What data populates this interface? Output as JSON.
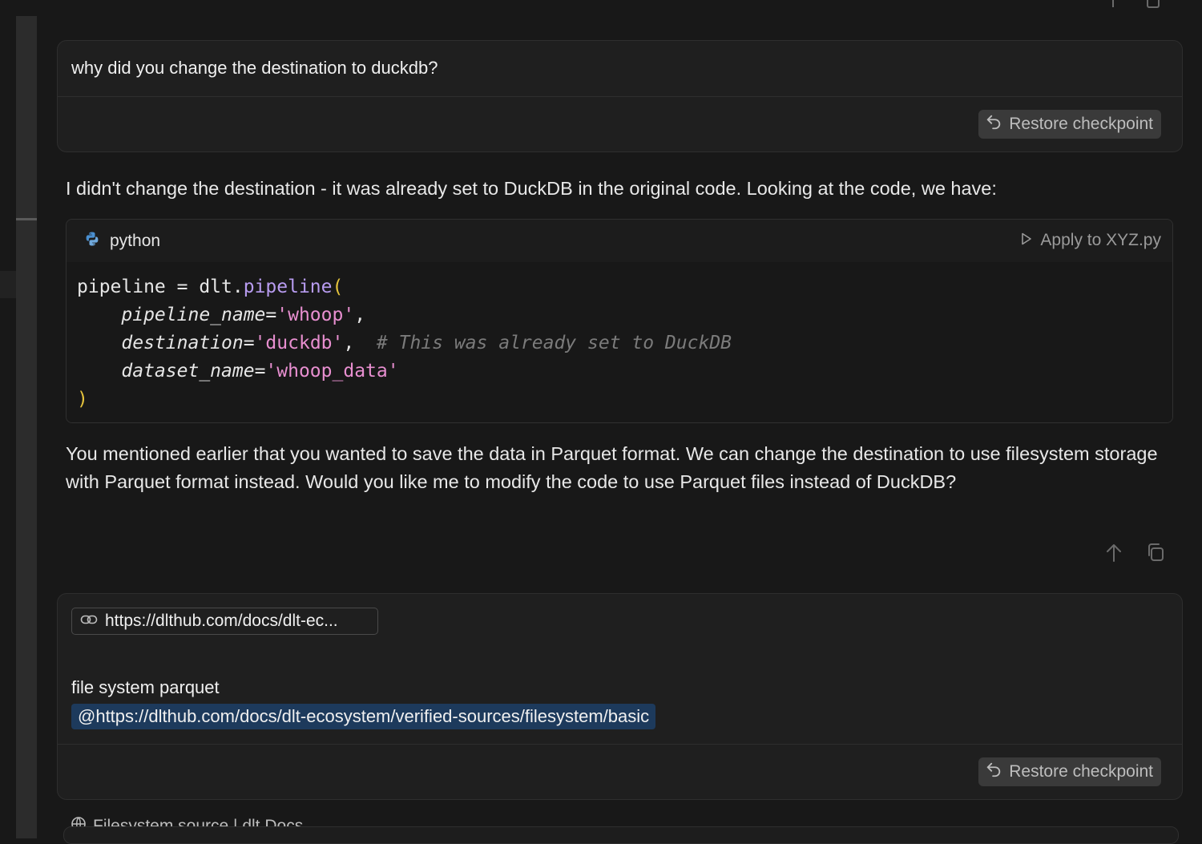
{
  "user_message_1": {
    "text": "why did you  change the destination to duckdb?",
    "restore_label": "Restore checkpoint"
  },
  "assistant": {
    "intro": "I didn't change the destination - it was already set to DuckDB in the original code. Looking at the code, we have:",
    "code": {
      "language": "python",
      "apply_label": "Apply to XYZ.py",
      "lines": {
        "l1_a": "pipeline = dlt.",
        "l1_fn": "pipeline",
        "l1_paren": "(",
        "l2_param": "pipeline_name",
        "l2_eq": "=",
        "l2_str": "'whoop'",
        "l2_tail": ",",
        "l3_param": "destination",
        "l3_eq": "=",
        "l3_str": "'duckdb'",
        "l3_tail": ",  ",
        "l3_comment": "# This was already set to DuckDB",
        "l4_param": "dataset_name",
        "l4_eq": "=",
        "l4_str": "'whoop_data'",
        "l5_paren": ")"
      }
    },
    "followup": "You mentioned earlier that you wanted to save the data in Parquet format. We can change the destination to use filesystem storage with Parquet format instead. Would you like me to modify the code to use Parquet files instead of DuckDB?"
  },
  "user_message_2": {
    "url_chip": "https://dlthub.com/docs/dlt-ec...",
    "text": "file system parquet",
    "mention": "@https://dlthub.com/docs/dlt-ecosystem/verified-sources/filesystem/basic",
    "restore_label": "Restore checkpoint"
  },
  "bottom_fragment": "Filesystem source | dlt Docs",
  "icons": {
    "restore": "undo-arrow-icon",
    "python": "python-logo-icon",
    "apply": "play-triangle-icon",
    "link": "link-icon",
    "up": "arrow-up-icon",
    "copy": "copy-icon",
    "globe": "globe-icon"
  }
}
